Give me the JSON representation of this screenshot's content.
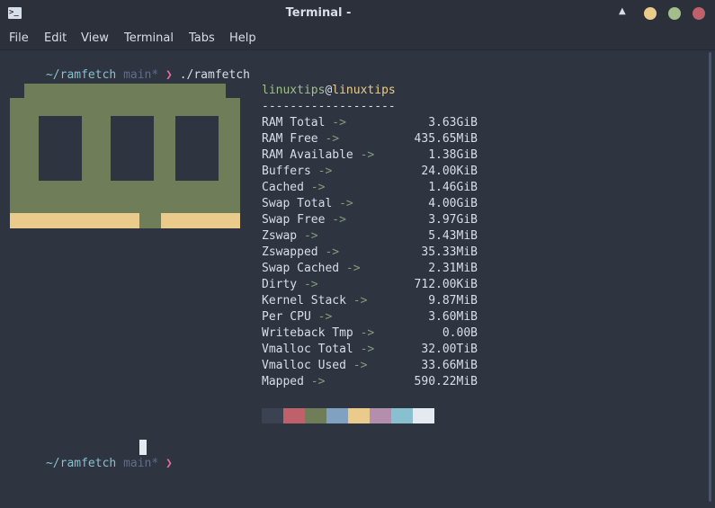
{
  "window": {
    "title": "Terminal -",
    "app_icon_glyph": ">_",
    "buttons": [
      {
        "name": "minimize-button",
        "color": "#ebcb8b"
      },
      {
        "name": "maximize-button",
        "color": "#a3be8c"
      },
      {
        "name": "close-button",
        "color": "#bf616a"
      }
    ]
  },
  "menu": [
    "File",
    "Edit",
    "View",
    "Terminal",
    "Tabs",
    "Help"
  ],
  "prompt": {
    "dir": "~/ramfetch",
    "branch": "main*",
    "symbol": "❯",
    "command": "./ramfetch"
  },
  "header": {
    "user": "linuxtips",
    "at": "@",
    "host": "linuxtips",
    "separator": "-------------------"
  },
  "stats": [
    {
      "label": "RAM Total",
      "value": "3.63GiB"
    },
    {
      "label": "RAM Free",
      "value": "435.65MiB"
    },
    {
      "label": "RAM Available",
      "value": "1.38GiB"
    },
    {
      "label": "Buffers",
      "value": "24.00KiB"
    },
    {
      "label": "Cached",
      "value": "1.46GiB"
    },
    {
      "label": "Swap Total",
      "value": "4.00GiB"
    },
    {
      "label": "Swap Free",
      "value": "3.97GiB"
    },
    {
      "label": "Zswap",
      "value": "5.43MiB"
    },
    {
      "label": "Zswapped",
      "value": "35.33MiB"
    },
    {
      "label": "Swap Cached",
      "value": "2.31MiB"
    },
    {
      "label": "Dirty",
      "value": "712.00KiB"
    },
    {
      "label": "Kernel Stack",
      "value": "9.87MiB"
    },
    {
      "label": "Per CPU",
      "value": "3.60MiB"
    },
    {
      "label": "Writeback Tmp",
      "value": "0.00B"
    },
    {
      "label": "Vmalloc Total",
      "value": "32.00TiB"
    },
    {
      "label": "Vmalloc Used",
      "value": "33.66MiB"
    },
    {
      "label": "Mapped",
      "value": "590.22MiB"
    }
  ],
  "arrow_text": "->",
  "palette": [
    "#3b4252",
    "#bf616a",
    "#6f7d58",
    "#81a1c1",
    "#ebcb8b",
    "#b48ead",
    "#88c0d0",
    "#e5e9f0"
  ],
  "colors": {
    "background": "#2e3440",
    "prompt_dir": "#88c0d0",
    "prompt_branch": "#616e88",
    "prompt_symbol": "#e06c9f",
    "user": "#a3be8c",
    "host": "#ebcb8b",
    "logo_green": "#6f7d58",
    "logo_gold": "#ebcb8b"
  }
}
